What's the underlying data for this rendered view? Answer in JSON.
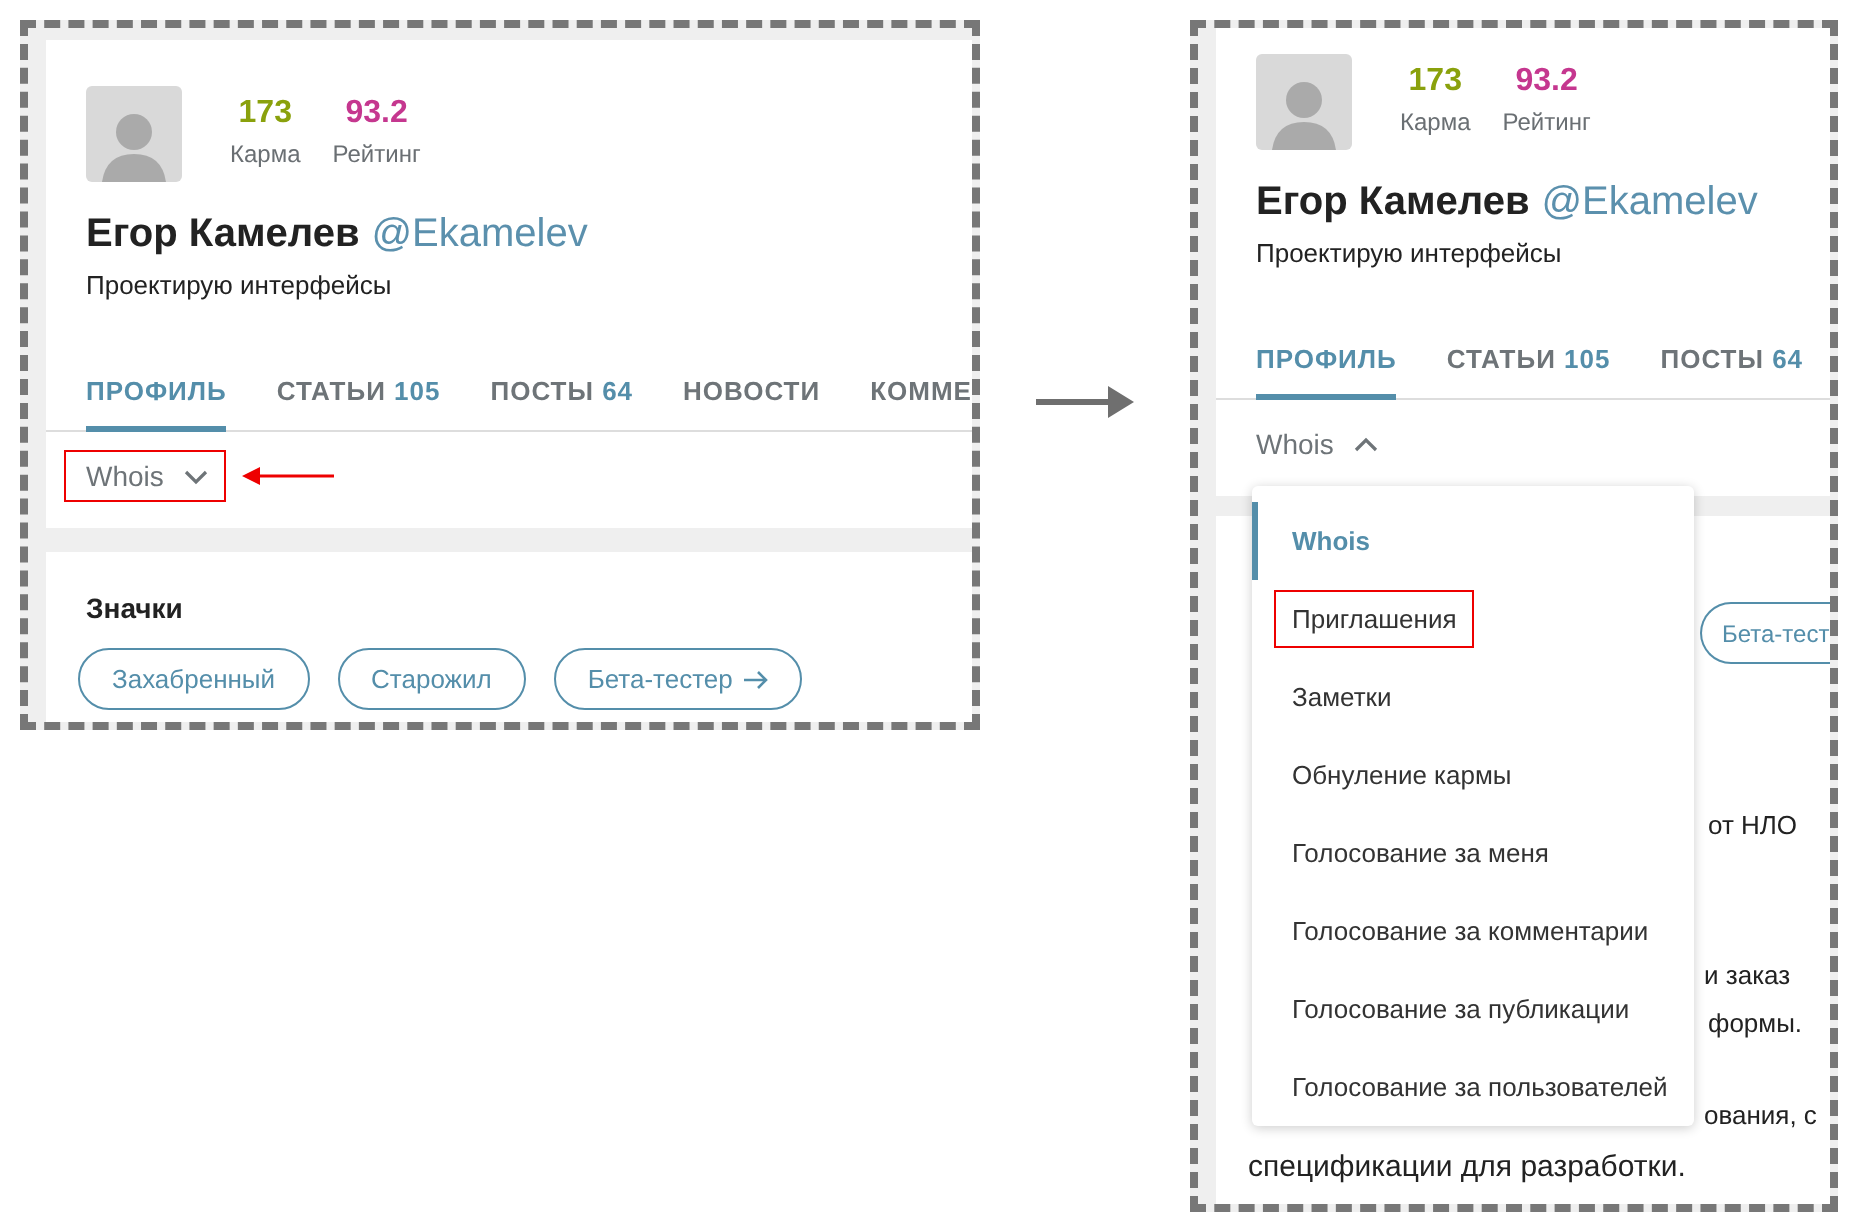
{
  "before": {
    "profile": {
      "karma": {
        "value": "173",
        "label": "Карма"
      },
      "rating": {
        "value": "93.2",
        "label": "Рейтинг"
      },
      "name": "Егор Камелев",
      "handle": "@Ekamelev",
      "bio": "Проектирую интерфейсы"
    },
    "tabs": [
      {
        "label": "ПРОФИЛЬ",
        "selected": true
      },
      {
        "label": "СТАТЬИ",
        "count": "105",
        "selected": false
      },
      {
        "label": "ПОСТЫ",
        "count": "64",
        "selected": false
      },
      {
        "label": "НОВОСТИ",
        "selected": false
      },
      {
        "label": "КОММЕ",
        "selected": false
      }
    ],
    "whois": {
      "label": "Whois",
      "expanded": false,
      "annotated": true
    },
    "badges": {
      "title": "Значки",
      "items": [
        {
          "label": "Захабренный",
          "kind": "plain"
        },
        {
          "label": "Старожил",
          "kind": "plain"
        },
        {
          "label": "Бета-тестер",
          "kind": "link"
        }
      ]
    }
  },
  "after": {
    "profile": {
      "karma": {
        "value": "173",
        "label": "Карма"
      },
      "rating": {
        "value": "93.2",
        "label": "Рейтинг"
      },
      "name": "Егор Камелев",
      "handle": "@Ekamelev",
      "bio": "Проектирую интерфейсы"
    },
    "tabs": [
      {
        "label": "ПРОФИЛЬ",
        "selected": true
      },
      {
        "label": "СТАТЬИ",
        "count": "105",
        "selected": false
      },
      {
        "label": "ПОСТЫ",
        "count": "64",
        "selected": false
      }
    ],
    "whois": {
      "label": "Whois",
      "expanded": true,
      "annotated": false
    },
    "background": {
      "badge": "Бета-тест",
      "fragments": [
        "от НЛО",
        "и заказ",
        "формы.",
        "ования, с",
        "спецификации для разработки."
      ]
    },
    "menu": [
      {
        "label": "Whois",
        "selected": true,
        "annotated": false
      },
      {
        "label": "Приглашения",
        "selected": false,
        "annotated": true
      },
      {
        "label": "Заметки",
        "selected": false,
        "annotated": false
      },
      {
        "label": "Обнуление кармы",
        "selected": false,
        "annotated": false
      },
      {
        "label": "Голосование за меня",
        "selected": false,
        "annotated": false
      },
      {
        "label": "Голосование за комментарии",
        "selected": false,
        "annotated": false
      },
      {
        "label": "Голосование за публикации",
        "selected": false,
        "annotated": false
      },
      {
        "label": "Голосование за пользователей",
        "selected": false,
        "annotated": false
      }
    ]
  }
}
